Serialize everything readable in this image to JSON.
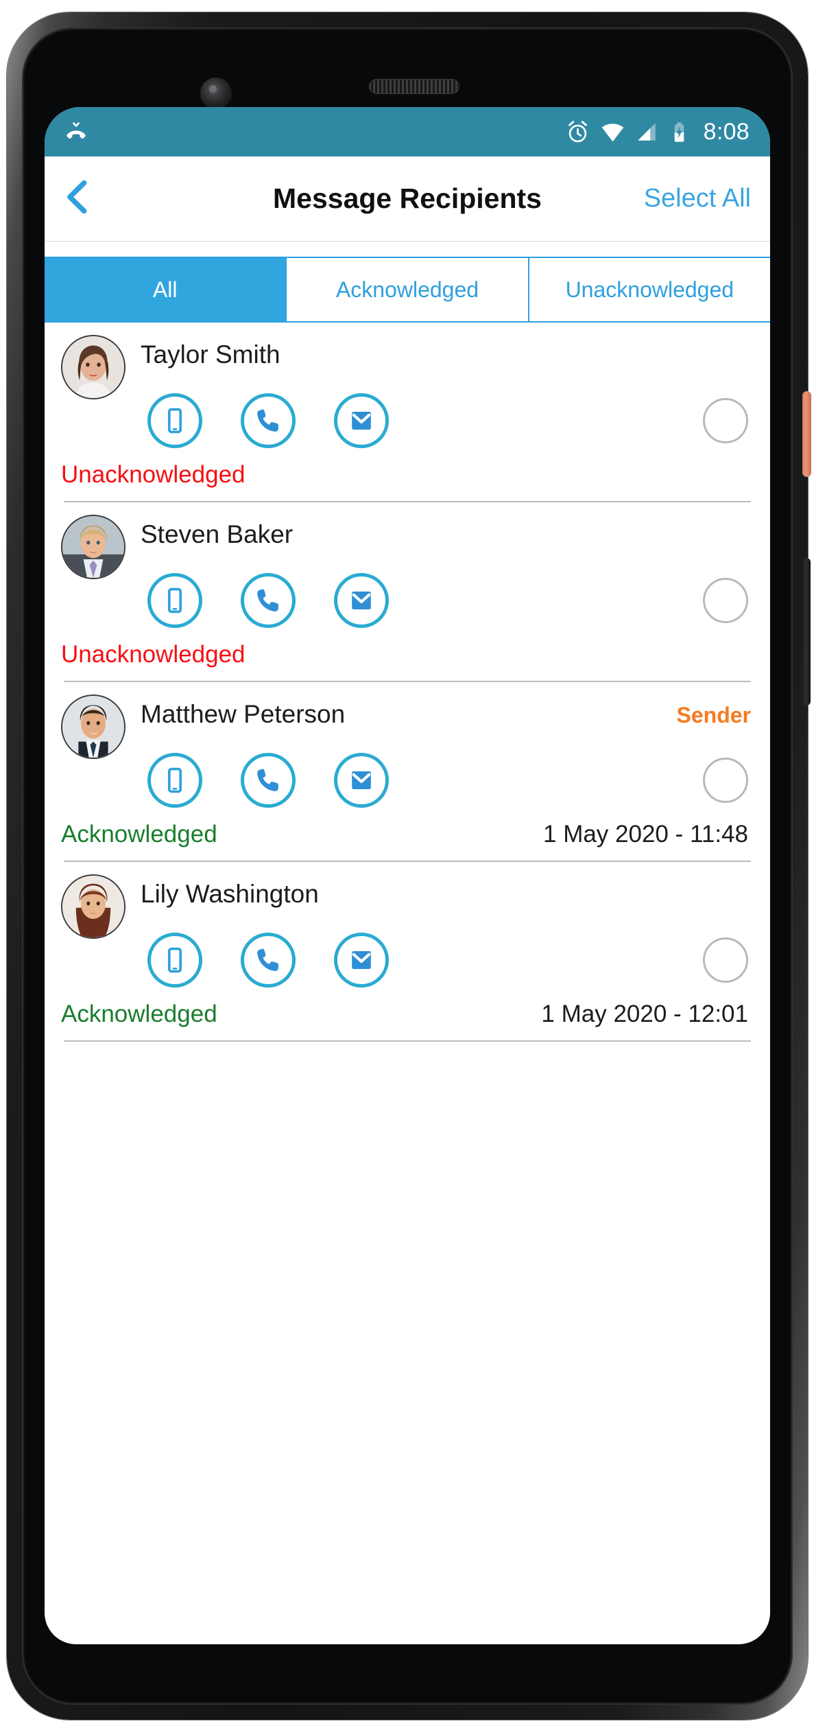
{
  "device": {
    "hardware": {
      "front_camera": "front-camera",
      "earpiece": "earpiece-speaker",
      "power_button": "power-button",
      "volume_button": "volume-button"
    }
  },
  "status_bar": {
    "left_icon": "missed-call-icon",
    "icons": [
      "alarm-icon",
      "wifi-icon",
      "cell-signal-icon",
      "battery-charging-icon"
    ],
    "clock": "8:08",
    "background": "#3089a3"
  },
  "nav_bar": {
    "back_icon": "chevron-left-icon",
    "title": "Message Recipients",
    "select_all_label": "Select All",
    "accent": "#3aa6e0"
  },
  "tabs": [
    {
      "label": "All",
      "active": true
    },
    {
      "label": "Acknowledged",
      "active": false
    },
    {
      "label": "Unacknowledged",
      "active": false
    }
  ],
  "colors": {
    "tab_active_bg": "#31a5de",
    "tab_text": "#2fa0dd",
    "action_icon": "#2aabd2",
    "unacknowledged": "#f60f12",
    "acknowledged": "#1a7d2e",
    "sender": "#f47b20",
    "status_bar": "#3089a3"
  },
  "actions": {
    "sms_label": "sms-icon",
    "call_label": "phone-icon",
    "email_label": "email-icon"
  },
  "recipients": [
    {
      "name": "Taylor Smith",
      "badge": "",
      "status": "Unacknowledged",
      "status_type": "unack",
      "timestamp": "",
      "selected": false,
      "avatar": "woman-brunette"
    },
    {
      "name": "Steven Baker",
      "badge": "",
      "status": "Unacknowledged",
      "status_type": "unack",
      "timestamp": "",
      "selected": false,
      "avatar": "man-blond"
    },
    {
      "name": "Matthew Peterson",
      "badge": "Sender",
      "status": "Acknowledged",
      "status_type": "ack",
      "timestamp": "1 May 2020 - 11:48",
      "selected": false,
      "avatar": "man-dark"
    },
    {
      "name": "Lily Washington",
      "badge": "",
      "status": "Acknowledged",
      "status_type": "ack",
      "timestamp": "1 May 2020 - 12:01",
      "selected": false,
      "avatar": "woman-red"
    }
  ]
}
